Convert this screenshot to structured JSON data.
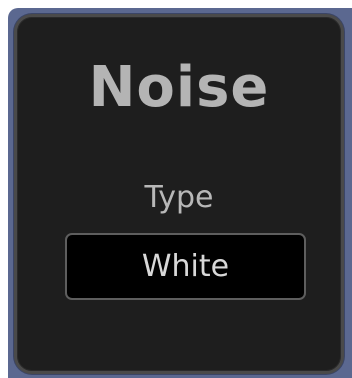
{
  "panel": {
    "title": "Noise",
    "type_label": "Type",
    "type_value": "White"
  },
  "colors": {
    "frame": "#5b6890",
    "panel_background": "#1e1e1e",
    "panel_border": "#4a4a4a",
    "title_text": "#b4b4b4",
    "label_text": "#b8b8b8",
    "select_background": "#000000",
    "select_border": "#5e5e5e",
    "select_text": "#d8d8d8"
  }
}
